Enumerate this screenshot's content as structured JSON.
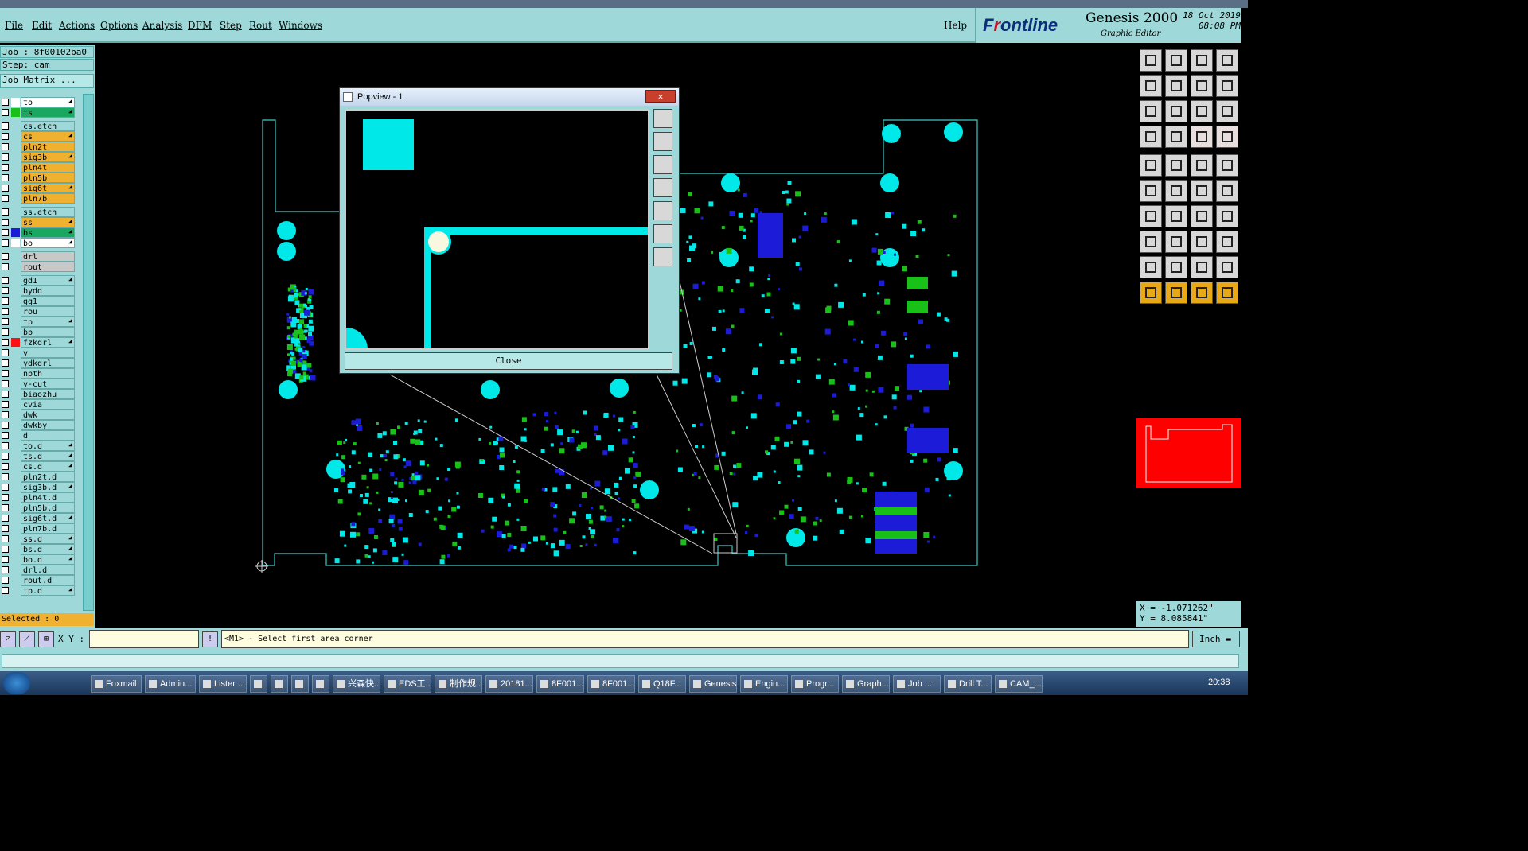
{
  "menu": [
    "File",
    "Edit",
    "Actions",
    "Options",
    "Analysis",
    "DFM",
    "Step",
    "Rout",
    "Windows"
  ],
  "help": "Help",
  "brand": {
    "logo_left": "F",
    "logo_mid": "r",
    "logo_rest": "ontline",
    "product": "Genesis 2000",
    "subtitle": "Graphic Editor",
    "date": "18 Oct 2019",
    "time": "08:08 PM"
  },
  "job": {
    "job": "Job : 8f00102ba0",
    "step": "Step: cam",
    "matrix": "Job Matrix ..."
  },
  "layers": [
    {
      "name": "to",
      "bg": "#ffffff",
      "sw": "#ffffff",
      "arrow": true
    },
    {
      "name": "ts",
      "bg": "#1aa860",
      "sw": "#18c018",
      "arrow": true
    },
    {
      "name": "cs.etch",
      "bg": "#9fd8d8",
      "sw": "#9fd8d8",
      "arrow": false,
      "gap": true
    },
    {
      "name": "cs",
      "bg": "#f0b030",
      "sw": "#9fd8d8",
      "arrow": true
    },
    {
      "name": "pln2t",
      "bg": "#f0b030",
      "sw": "#9fd8d8",
      "arrow": false
    },
    {
      "name": "sig3b",
      "bg": "#f0b030",
      "sw": "#9fd8d8",
      "arrow": true
    },
    {
      "name": "pln4t",
      "bg": "#f0b030",
      "sw": "#9fd8d8",
      "arrow": false
    },
    {
      "name": "pln5b",
      "bg": "#f0b030",
      "sw": "#9fd8d8",
      "arrow": false
    },
    {
      "name": "sig6t",
      "bg": "#f0b030",
      "sw": "#9fd8d8",
      "arrow": true
    },
    {
      "name": "pln7b",
      "bg": "#f0b030",
      "sw": "#9fd8d8",
      "arrow": false
    },
    {
      "name": "ss.etch",
      "bg": "#9fd8d8",
      "sw": "#9fd8d8",
      "arrow": false,
      "gap": true
    },
    {
      "name": "ss",
      "bg": "#f0b030",
      "sw": "#9fd8d8",
      "arrow": true
    },
    {
      "name": "bs",
      "bg": "#1aa860",
      "sw": "#1c1cd8",
      "arrow": true
    },
    {
      "name": "bo",
      "bg": "#ffffff",
      "sw": "#ffffff",
      "arrow": true
    },
    {
      "name": "drl",
      "bg": "#c8c8c8",
      "sw": "#9fd8d8",
      "arrow": false,
      "gap": true
    },
    {
      "name": "rout",
      "bg": "#c8c8c8",
      "sw": "#9fd8d8",
      "arrow": false
    },
    {
      "name": "gd1",
      "bg": "#9fd8d8",
      "sw": "#9fd8d8",
      "arrow": true,
      "gap": true
    },
    {
      "name": "bydd",
      "bg": "#9fd8d8",
      "sw": "#9fd8d8",
      "arrow": false
    },
    {
      "name": "gg1",
      "bg": "#9fd8d8",
      "sw": "#9fd8d8",
      "arrow": false
    },
    {
      "name": "rou",
      "bg": "#9fd8d8",
      "sw": "#9fd8d8",
      "arrow": false
    },
    {
      "name": "tp",
      "bg": "#9fd8d8",
      "sw": "#9fd8d8",
      "arrow": true
    },
    {
      "name": "bp",
      "bg": "#9fd8d8",
      "sw": "#9fd8d8",
      "arrow": false
    },
    {
      "name": "fzkdrl",
      "bg": "#9fd8d8",
      "sw": "#ff1010",
      "arrow": true
    },
    {
      "name": "v",
      "bg": "#9fd8d8",
      "sw": "#9fd8d8",
      "arrow": false
    },
    {
      "name": "ydkdrl",
      "bg": "#9fd8d8",
      "sw": "#9fd8d8",
      "arrow": false
    },
    {
      "name": "npth",
      "bg": "#9fd8d8",
      "sw": "#9fd8d8",
      "arrow": false
    },
    {
      "name": "v-cut",
      "bg": "#9fd8d8",
      "sw": "#9fd8d8",
      "arrow": false
    },
    {
      "name": "biaozhu",
      "bg": "#9fd8d8",
      "sw": "#9fd8d8",
      "arrow": false
    },
    {
      "name": "cvia",
      "bg": "#9fd8d8",
      "sw": "#9fd8d8",
      "arrow": false
    },
    {
      "name": "dwk",
      "bg": "#9fd8d8",
      "sw": "#9fd8d8",
      "arrow": false
    },
    {
      "name": "dwkby",
      "bg": "#9fd8d8",
      "sw": "#9fd8d8",
      "arrow": false
    },
    {
      "name": "d",
      "bg": "#9fd8d8",
      "sw": "#9fd8d8",
      "arrow": false
    },
    {
      "name": "to.d",
      "bg": "#9fd8d8",
      "sw": "#9fd8d8",
      "arrow": true
    },
    {
      "name": "ts.d",
      "bg": "#9fd8d8",
      "sw": "#9fd8d8",
      "arrow": true
    },
    {
      "name": "cs.d",
      "bg": "#9fd8d8",
      "sw": "#9fd8d8",
      "arrow": true
    },
    {
      "name": "pln2t.d",
      "bg": "#9fd8d8",
      "sw": "#9fd8d8",
      "arrow": false
    },
    {
      "name": "sig3b.d",
      "bg": "#9fd8d8",
      "sw": "#9fd8d8",
      "arrow": true
    },
    {
      "name": "pln4t.d",
      "bg": "#9fd8d8",
      "sw": "#9fd8d8",
      "arrow": false
    },
    {
      "name": "pln5b.d",
      "bg": "#9fd8d8",
      "sw": "#9fd8d8",
      "arrow": false
    },
    {
      "name": "sig6t.d",
      "bg": "#9fd8d8",
      "sw": "#9fd8d8",
      "arrow": true
    },
    {
      "name": "pln7b.d",
      "bg": "#9fd8d8",
      "sw": "#9fd8d8",
      "arrow": false
    },
    {
      "name": "ss.d",
      "bg": "#9fd8d8",
      "sw": "#9fd8d8",
      "arrow": true
    },
    {
      "name": "bs.d",
      "bg": "#9fd8d8",
      "sw": "#9fd8d8",
      "arrow": true
    },
    {
      "name": "bo.d",
      "bg": "#9fd8d8",
      "sw": "#9fd8d8",
      "arrow": true
    },
    {
      "name": "drl.d",
      "bg": "#9fd8d8",
      "sw": "#9fd8d8",
      "arrow": false
    },
    {
      "name": "rout.d",
      "bg": "#9fd8d8",
      "sw": "#9fd8d8",
      "arrow": false
    },
    {
      "name": "tp.d",
      "bg": "#9fd8d8",
      "sw": "#9fd8d8",
      "arrow": true
    }
  ],
  "selected": "Selected : 0",
  "popview": {
    "title": "Popview - 1",
    "close_x": "✕",
    "close_label": "Close"
  },
  "bottom": {
    "xy_label": "X Y :",
    "xy_value": "",
    "prompt": "<M1> - Select first area corner",
    "unit": "Inch"
  },
  "coords": {
    "x": "X = -1.071262\"",
    "y": "Y = 8.085841\""
  },
  "taskbar": {
    "items": [
      "Foxmail",
      "Admin...",
      "Lister ...",
      "",
      "",
      "",
      "",
      "兴森快...",
      "EDS工...",
      "制作规...",
      "20181...",
      "8F001...",
      "8F001...",
      "Q18F...",
      "Genesis",
      "Engin...",
      "Progr...",
      "Graph...",
      "Job ...",
      "Drill T...",
      "CAM_..."
    ],
    "clock": "20:38"
  },
  "colors": {
    "pad": "#00e8e8",
    "outline": "#40c8c8",
    "green": "#18c018",
    "blue": "#1c1cd8",
    "accent": "#9fd8d8"
  }
}
